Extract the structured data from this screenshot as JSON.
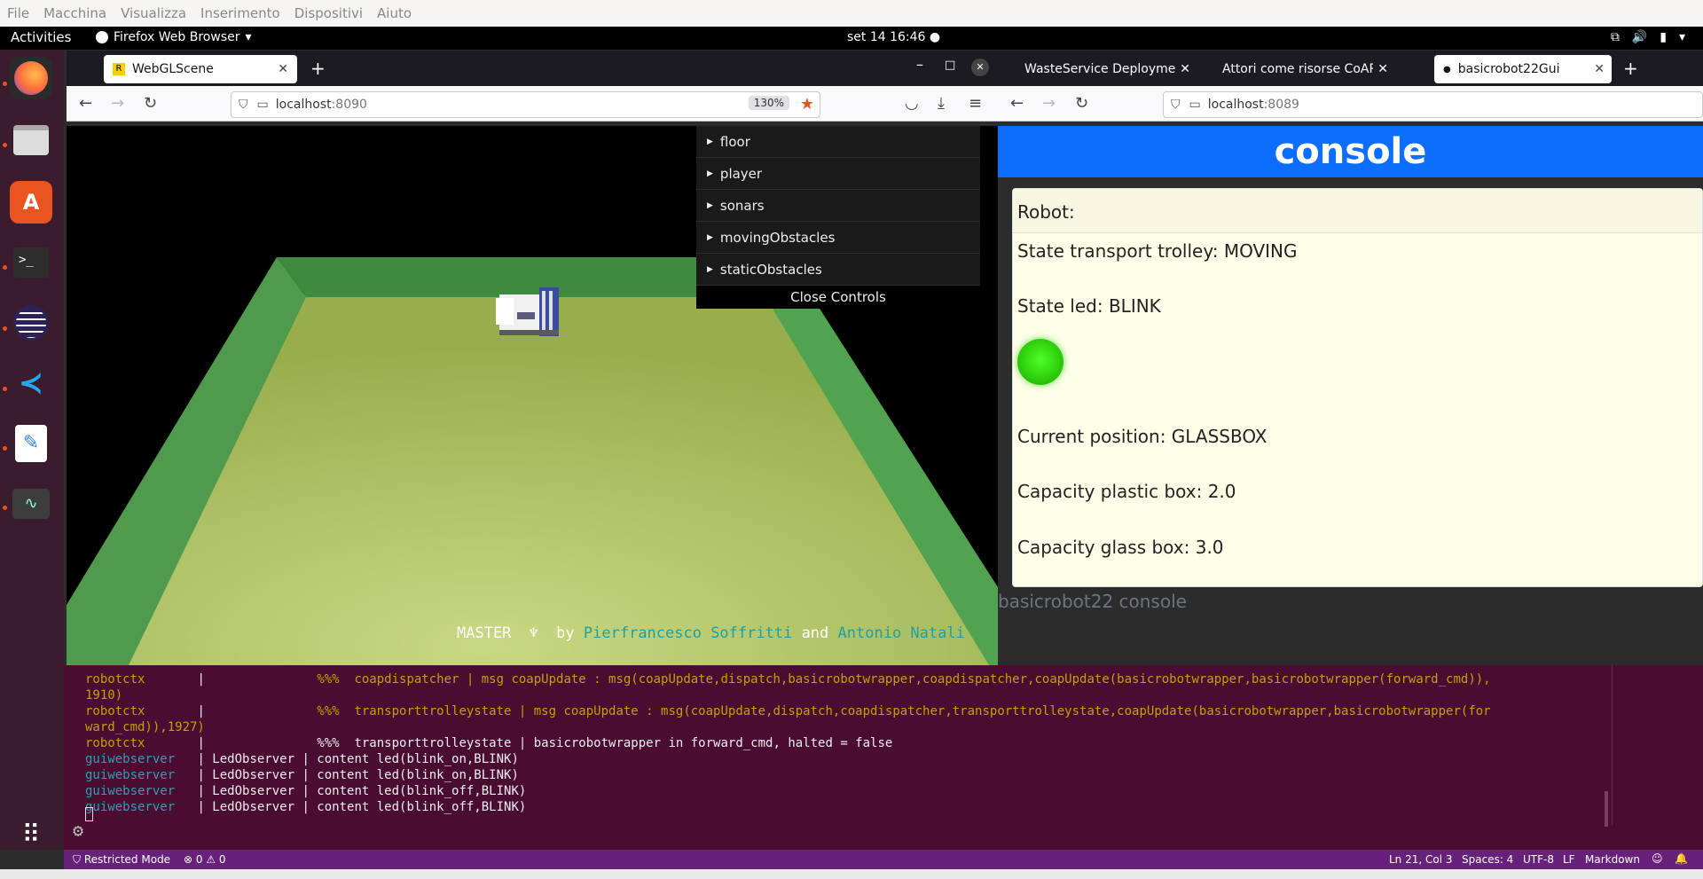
{
  "vbox_menu": [
    "File",
    "Macchina",
    "Visualizza",
    "Inserimento",
    "Dispositivi",
    "Aiuto"
  ],
  "topbar": {
    "activities": "Activities",
    "app_name": "Firefox Web Browser",
    "clock": "set 14  16:46"
  },
  "dock_items": [
    "firefox-icon",
    "files-icon",
    "software-icon",
    "terminal-icon",
    "eclipse-icon",
    "vscode-icon",
    "text-editor-icon",
    "system-monitor-icon",
    "apps-grid-icon"
  ],
  "left_window": {
    "tab_title": "WebGLScene",
    "url_host": "localhost",
    "url_port": ":8090",
    "zoom": "130%",
    "gui_folders": [
      "floor",
      "player",
      "sonars",
      "movingObstacles",
      "staticObstacles"
    ],
    "close_controls": "Close Controls",
    "credits": {
      "master": "MASTER",
      "by": "by",
      "author1": "Pierfrancesco Soffritti",
      "and": "and",
      "author2": "Antonio Natali"
    }
  },
  "right_window": {
    "tabs": [
      "WasteService Deployment -",
      "Attori come risorse CoAP —",
      "basicrobot22Gui"
    ],
    "url_host": "localhost",
    "url_port": ":8089",
    "header": "console",
    "card_title": "Robot:",
    "lines": {
      "trolley": "State transport trolley: MOVING",
      "led": "State led: BLINK",
      "position": "Current position: GLASSBOX",
      "plastic": "Capacity plastic box: 2.0",
      "glass": "Capacity glass box: 3.0"
    },
    "led_color": "#2fd10d",
    "footer": "basicrobot22 console"
  },
  "terminal_lines": [
    {
      "src": "robotctx       ",
      "sep": "|",
      "text": "               %%%  coapdispatcher | msg coapUpdate : msg(coapUpdate,dispatch,basicrobotwrapper,coapdispatcher,coapUpdate(basicrobotwrapper,basicrobotwrapper(forward_cmd)),",
      "color": "yellow"
    },
    {
      "src": "",
      "sep": "",
      "text": "1910)",
      "color": "yellow"
    },
    {
      "src": "robotctx       ",
      "sep": "|",
      "text": "               %%%  transporttrolleystate | msg coapUpdate : msg(coapUpdate,dispatch,coapdispatcher,transporttrolleystate,coapUpdate(basicrobotwrapper,basicrobotwrapper(for",
      "color": "yellow"
    },
    {
      "src": "",
      "sep": "",
      "text": "ward_cmd)),1927)",
      "color": "yellow"
    },
    {
      "src": "robotctx       ",
      "sep": "|",
      "text": "               %%%  transporttrolleystate | basicrobotwrapper in forward_cmd, halted = false",
      "color": "white"
    },
    {
      "src": "guiwebserver   ",
      "sep": "|",
      "text": " LedObserver | content led(blink_on,BLINK)",
      "color": "cyan"
    },
    {
      "src": "guiwebserver   ",
      "sep": "|",
      "text": " LedObserver | content led(blink_on,BLINK)",
      "color": "cyan"
    },
    {
      "src": "guiwebserver   ",
      "sep": "|",
      "text": " LedObserver | content led(blink_off,BLINK)",
      "color": "cyan"
    },
    {
      "src": "guiwebserver   ",
      "sep": "|",
      "text": " LedObserver | content led(blink_off,BLINK)",
      "color": "cyan"
    }
  ],
  "status_bar": {
    "restricted": "Restricted Mode",
    "problems": "⊗ 0 ⚠ 0",
    "position": "Ln 21, Col 3",
    "spaces": "Spaces: 4",
    "encoding": "UTF-8",
    "eol": "LF",
    "language": "Markdown"
  }
}
